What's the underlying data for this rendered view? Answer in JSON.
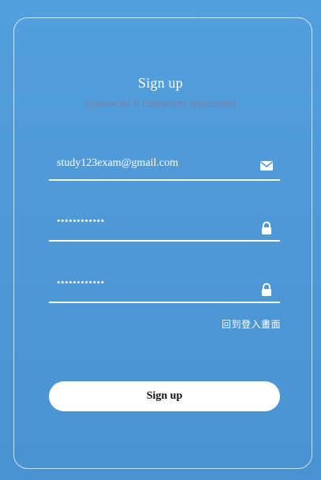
{
  "form": {
    "title": "Sign up",
    "subtitle": "(password 6 characters minimum)",
    "email_value": "study123exam@gmail.com",
    "password_value": "••••••••••••",
    "confirm_password_value": "••••••••••••",
    "back_to_login_link": "回到登入畫面",
    "submit_label": "Sign up"
  },
  "icons": {
    "email": "envelope-icon",
    "password": "lock-icon",
    "confirm": "lock-icon"
  },
  "colors": {
    "background": "#4e98d6",
    "subtitle": "#7e7fa0",
    "text": "#ffffff",
    "button_bg": "#ffffff",
    "button_text": "#111111"
  }
}
